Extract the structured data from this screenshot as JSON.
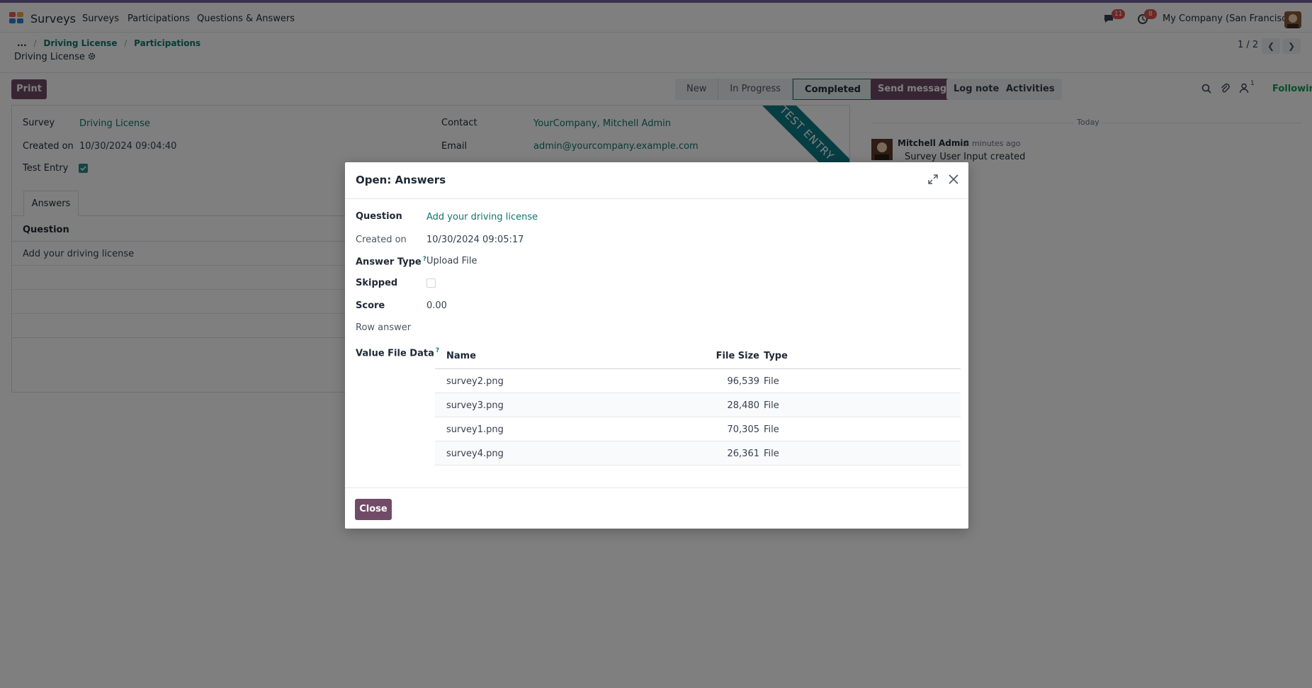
{
  "topbar": {
    "app_name": "Surveys",
    "menu": [
      "Surveys",
      "Participations",
      "Questions & Answers"
    ],
    "messages_count": "11",
    "activities_count": "8",
    "company": "My Company (San Francisco)"
  },
  "breadcrumb": {
    "ellipsis": "...",
    "items": [
      "Driving License",
      "Participations"
    ],
    "current": "Driving License"
  },
  "pager": {
    "value": "1 / 2"
  },
  "controls": {
    "print": "Print"
  },
  "status_bar": [
    "New",
    "In Progress",
    "Completed"
  ],
  "status_active": "Completed",
  "form": {
    "ribbon": "TEST ENTRY",
    "survey_label": "Survey",
    "survey_value": "Driving License",
    "created_on_label": "Created on",
    "created_on_value": "10/30/2024 09:04:40",
    "test_entry_label": "Test Entry",
    "test_entry_checked": true,
    "contact_label": "Contact",
    "contact_value": "YourCompany, Mitchell Admin",
    "email_label": "Email",
    "email_value": "admin@yourcompany.example.com",
    "tab_answers": "Answers",
    "list_header": "Question",
    "list_rows": [
      "Add your driving license"
    ]
  },
  "chatter": {
    "send_message": "Send message",
    "log_note": "Log note",
    "activities": "Activities",
    "followers_count": "1",
    "following": "Following",
    "date_separator": "Today",
    "message": {
      "author": "Mitchell Admin",
      "time": "- 2 minutes ago",
      "body": "Survey User Input created"
    }
  },
  "modal": {
    "title": "Open: Answers",
    "question_label": "Question",
    "question_value": "Add your driving license",
    "created_on_label": "Created on",
    "created_on_value": "10/30/2024 09:05:17",
    "answer_type_label": "Answer Type",
    "help_mark": "?",
    "answer_type_value": "Upload File",
    "skipped_label": "Skipped",
    "skipped_checked": false,
    "score_label": "Score",
    "score_value": "0.00",
    "row_answer_label": "Row answer",
    "value_file_data_label": "Value File Data",
    "file_table": {
      "columns": [
        "Name",
        "File Size",
        "Type"
      ],
      "rows": [
        {
          "name": "survey2.png",
          "size": "96,539",
          "type": "File"
        },
        {
          "name": "survey3.png",
          "size": "28,480",
          "type": "File"
        },
        {
          "name": "survey1.png",
          "size": "70,305",
          "type": "File"
        },
        {
          "name": "survey4.png",
          "size": "26,361",
          "type": "File"
        }
      ]
    },
    "close_button": "Close"
  },
  "colors": {
    "primary": "#714b67",
    "link": "#0f766e",
    "ribbon": "#0f7c87",
    "top_border": "#71639e"
  },
  "icons": [
    "apps-icon",
    "chat-icon",
    "clock-icon",
    "search-icon",
    "paperclip-icon",
    "user-icon",
    "expand-icon",
    "close-icon",
    "gear-icon",
    "chevron-left-icon",
    "chevron-right-icon"
  ]
}
